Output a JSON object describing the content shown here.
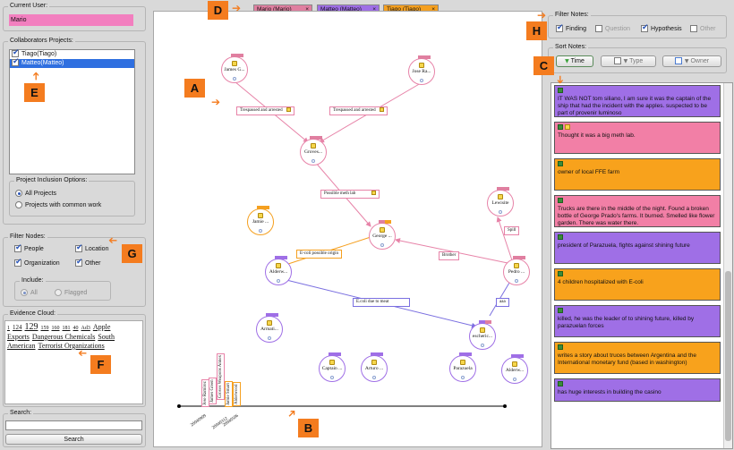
{
  "current_user": {
    "legend": "Current User:",
    "value": "Mario"
  },
  "collaborators": {
    "legend": "Collaborators Projects:",
    "items": [
      {
        "label": "Tiago(Tiago)",
        "checked": true
      },
      {
        "label": "Matteo(Matteo)",
        "checked": true
      }
    ]
  },
  "inclusion": {
    "legend": "Project Inclusion Options:",
    "all": "All Projects",
    "common": "Projects with common work"
  },
  "filter_nodes": {
    "legend": "Filter Nodes:",
    "people": "People",
    "location": "Location",
    "organization": "Organization",
    "other": "Other",
    "include": "Include:",
    "all": "All",
    "flagged": "Flagged"
  },
  "evidence_cloud": {
    "legend": "Evidence Cloud:",
    "words": [
      {
        "t": "1",
        "s": 6
      },
      {
        "t": "124",
        "s": 7
      },
      {
        "t": "129",
        "s": 10
      },
      {
        "t": "159",
        "s": 6
      },
      {
        "t": "160",
        "s": 6
      },
      {
        "t": "181",
        "s": 6
      },
      {
        "t": "40",
        "s": 6
      },
      {
        "t": "Ad3",
        "s": 6
      },
      {
        "t": "Apple Exports",
        "s": 8
      },
      {
        "t": "Dangerous Chemicals",
        "s": 8
      },
      {
        "t": "South American",
        "s": 8
      },
      {
        "t": "Terrorist Organizations",
        "s": 8
      }
    ]
  },
  "search": {
    "legend": "Search:",
    "button": "Search"
  },
  "tabs": [
    {
      "label": "Mario (Mario)",
      "color": "#e07fa0"
    },
    {
      "label": "Matteo (Matteo)",
      "color": "#9f6fe6"
    },
    {
      "label": "Tiago (Tiago)",
      "color": "#f5a020"
    }
  ],
  "close_glyph": "×",
  "filter_notes": {
    "legend": "Filter Notes:",
    "finding": "Finding",
    "question": "Question",
    "hypothesis": "Hypothesis",
    "other": "Other"
  },
  "sort_notes": {
    "legend": "Sort Notes:",
    "time": "Time",
    "type": "Type",
    "owner": "Owner"
  },
  "nodes": [
    {
      "label": "James G..."
    },
    {
      "label": "Jose Ra..."
    },
    {
      "label": "Groves..."
    },
    {
      "label": "Jamie ..."
    },
    {
      "label": "George ..."
    },
    {
      "label": "Lewisite"
    },
    {
      "label": "Alderw..."
    },
    {
      "label": "Pedro ..."
    },
    {
      "label": "Armati..."
    },
    {
      "label": "escheric..."
    },
    {
      "label": "Captain ..."
    },
    {
      "label": "Arturo ..."
    },
    {
      "label": "Parazuela"
    },
    {
      "label": "Alderw..."
    }
  ],
  "edges": [
    {
      "label": "Trespassed and arrested"
    },
    {
      "label": "Trespassed and arrested"
    },
    {
      "label": "Possible meth lab"
    },
    {
      "label": "E-coli possible origin"
    },
    {
      "label": "Brother"
    },
    {
      "label": "Spill"
    },
    {
      "label": "E.coli due to meat"
    },
    {
      "label": "aaa"
    }
  ],
  "timeline": {
    "names": [
      "Jose Ramirez",
      "James Green",
      "Groves Weapons Annex",
      "Jamie Smart",
      "Alderwood"
    ],
    "dates": [
      "20040909",
      "20040312",
      "20040506"
    ]
  },
  "notes": [
    {
      "text": "IT WAS NOT tom siliano, I am sure it was the captain of the ship that had the incident with the apples. suspected to be part of provenir luminoso",
      "color": "#9f6fe6",
      "yellow": false
    },
    {
      "text": "Thought it was a big meth lab.",
      "color": "#f27fa6",
      "yellow": true
    },
    {
      "text": "owner of local FFE farm",
      "color": "#f8a21c",
      "yellow": false
    },
    {
      "text": "Trucks are there in the middle of the night. Found a broken bottle of George Prado's farms. It burned. Smelled like flower garden. There was water there.",
      "color": "#f27fa6",
      "yellow": false
    },
    {
      "text": "president of Parazuela, fights against shining future",
      "color": "#9f6fe6",
      "yellow": false
    },
    {
      "text": "4 children hospitalized with E-coli",
      "color": "#f8a21c",
      "yellow": false
    },
    {
      "text": "killed, he was the leader of to shining future, killed by parazuelan forces",
      "color": "#9f6fe6",
      "yellow": false
    },
    {
      "text": "writes a story about truces between Argentina and the International monetary fund (based in washington)",
      "color": "#f8a21c",
      "yellow": false
    },
    {
      "text": "has huge interests in building the casino",
      "color": "#9f6fe6",
      "yellow": false
    }
  ],
  "annotations": {
    "A": "A",
    "B": "B",
    "C": "C",
    "D": "D",
    "E": "E",
    "F": "F",
    "G": "G",
    "H": "H"
  }
}
